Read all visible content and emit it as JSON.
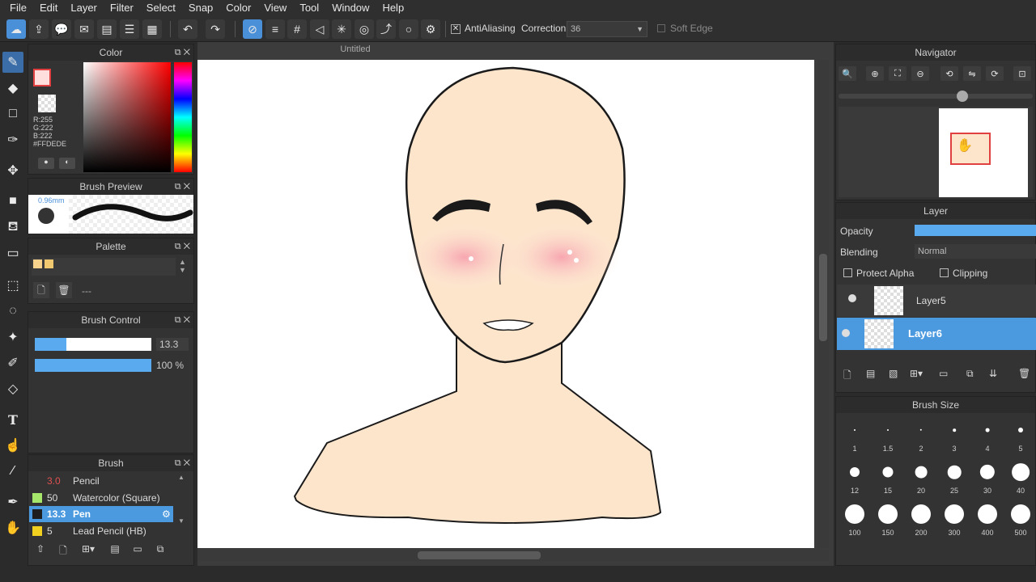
{
  "menu": [
    "File",
    "Edit",
    "Layer",
    "Filter",
    "Select",
    "Snap",
    "Color",
    "View",
    "Tool",
    "Window",
    "Help"
  ],
  "toolbar": {
    "antialiasing_label": "AntiAliasing",
    "correction_label": "Correction",
    "correction_value": "36",
    "soft_edge_label": "Soft Edge"
  },
  "color_panel": {
    "title": "Color",
    "rgb": "R:255\nG:222\nB:222",
    "hex": "#FFDEDE",
    "fg_color": "#ffdede"
  },
  "brush_preview": {
    "title": "Brush Preview",
    "size_label": "0.96mm"
  },
  "palette": {
    "title": "Palette",
    "dash": "---",
    "colors": [
      "#f6d28c",
      "#f0c870"
    ]
  },
  "brush_control": {
    "title": "Brush Control",
    "size_value": "13.3",
    "opacity_value": "100 %",
    "size_level": 0.27,
    "opacity_level": 1.0
  },
  "brush_panel": {
    "title": "Brush",
    "items": [
      {
        "size": "3.0",
        "name": "Pencil",
        "color": "#333"
      },
      {
        "size": "50",
        "name": "Watercolor (Square)",
        "color": "#a6e66a"
      },
      {
        "size": "13.3",
        "name": "Pen",
        "color": "#1e1e1e"
      },
      {
        "size": "5",
        "name": "Lead Pencil (HB)",
        "color": "#f2d020"
      }
    ]
  },
  "canvas": {
    "title": "Untitled"
  },
  "navigator": {
    "title": "Navigator"
  },
  "layer_panel": {
    "title": "Layer",
    "opacity_label": "Opacity",
    "blending_label": "Blending",
    "blending_value": "Normal",
    "protect_alpha_label": "Protect Alpha",
    "clipping_label": "Clipping",
    "layers": [
      "Layer5",
      "Layer6"
    ]
  },
  "brush_size": {
    "title": "Brush Size",
    "sizes": [
      "1",
      "1.5",
      "2",
      "3",
      "4",
      "5",
      "12",
      "15",
      "20",
      "25",
      "30",
      "40",
      "100",
      "150",
      "200",
      "300",
      "400",
      "500"
    ]
  }
}
